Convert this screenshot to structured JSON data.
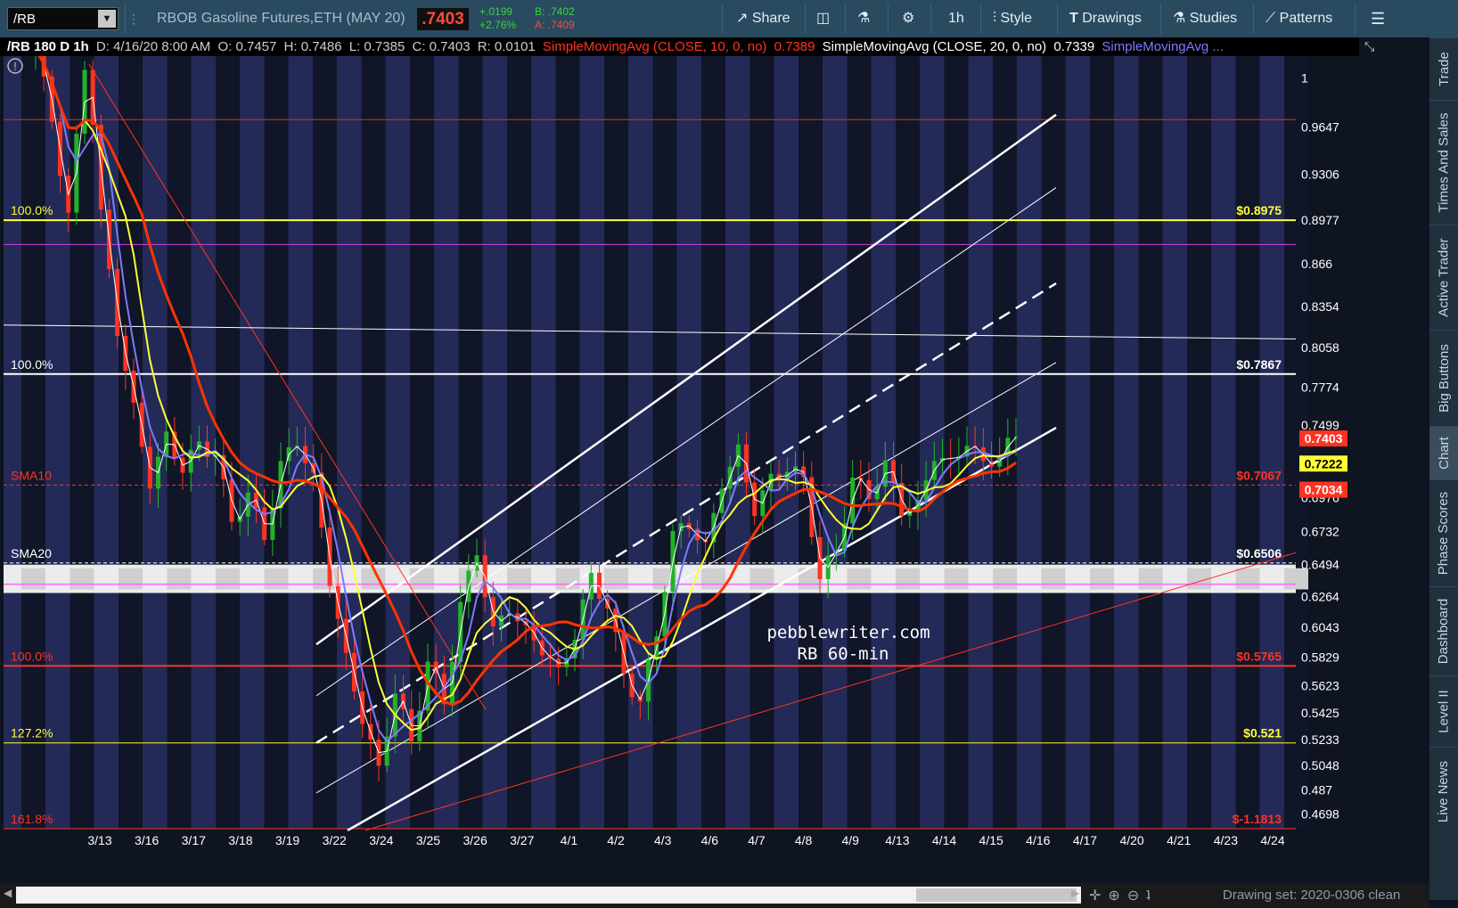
{
  "toolbar": {
    "symbol": "/RB",
    "description": "RBOB Gasoline Futures,ETH (MAY 20)",
    "last": ".7403",
    "change": "+.0199",
    "change_pct": "+2.76%",
    "bid": "B: .7402",
    "ask": "A: .7409",
    "share_label": "Share",
    "interval_label": "1h",
    "style_label": "Style",
    "drawings_label": "Drawings",
    "studies_label": "Studies",
    "patterns_label": "Patterns"
  },
  "header": {
    "title": "/RB 180 D 1h",
    "date": "D: 4/16/20 8:00 AM",
    "open": "O: 0.7457",
    "high": "H: 0.7486",
    "low": "L: 0.7385",
    "close": "C: 0.7403",
    "range": "R: 0.0101",
    "sma10": "SimpleMovingAvg (CLOSE, 10, 0, no)",
    "sma10_val": "0.7389",
    "sma20": "SimpleMovingAvg (CLOSE, 20, 0, no)",
    "sma20_val": "0.7339",
    "sma50": "SimpleMovingAvg ..."
  },
  "sidebar": {
    "items": [
      {
        "label": "Trade"
      },
      {
        "label": "Times And Sales"
      },
      {
        "label": "Active Trader"
      },
      {
        "label": "Big Buttons"
      },
      {
        "label": "Chart"
      },
      {
        "label": "Phase Scores"
      },
      {
        "label": "Dashboard"
      },
      {
        "label": "Level II"
      },
      {
        "label": "Live News"
      }
    ]
  },
  "bottom": {
    "drawing_set": "Drawing set: 2020-0306 clean"
  },
  "colors": {
    "background": "#242a57",
    "stripe": "#101528",
    "bull": "#22b22a",
    "bear": "#ff3322",
    "sma10": "#ffffff",
    "sma20": "#7b7bff",
    "sma50": "#ffff33",
    "sma100": "#ff3300"
  },
  "chart_data": {
    "type": "candlestick",
    "watermark": [
      "pebblewriter.com",
      "RB 60-min"
    ],
    "ylim": [
      0.4592,
      1.0157
    ],
    "y_ticks": [
      "1",
      "0.9647",
      "0.9306",
      "0.8977",
      "0.866",
      "0.8354",
      "0.8058",
      "0.7774",
      "0.7499",
      "0.7232",
      "0.6976",
      "0.6732",
      "0.6494",
      "0.6264",
      "0.6043",
      "0.5829",
      "0.5623",
      "0.5425",
      "0.5233",
      "0.5048",
      "0.487",
      "0.4698"
    ],
    "x_labels": [
      "3/13",
      "3/16",
      "3/17",
      "3/18",
      "3/19",
      "3/22",
      "3/24",
      "3/25",
      "3/26",
      "3/27",
      "4/1",
      "4/2",
      "4/3",
      "4/6",
      "4/7",
      "4/8",
      "4/9",
      "4/13",
      "4/14",
      "4/15",
      "4/16",
      "4/17",
      "4/20",
      "4/21",
      "4/23",
      "4/24"
    ],
    "price_badges": [
      {
        "value": "0.7403",
        "color": "#ff3322",
        "text": "#ffffff"
      },
      {
        "value": "0.7222",
        "color": "#ffff33",
        "text": "#000000"
      },
      {
        "value": "0.7034",
        "color": "#ff3322",
        "text": "#ffffff"
      }
    ],
    "price_path": [
      [
        0,
        1.02
      ],
      [
        2,
        0.97
      ],
      [
        4,
        0.9
      ],
      [
        6,
        1.01
      ],
      [
        7,
        0.97
      ],
      [
        8,
        0.9
      ],
      [
        10,
        0.82
      ],
      [
        12,
        0.76
      ],
      [
        14,
        0.71
      ],
      [
        16,
        0.74
      ],
      [
        18,
        0.72
      ],
      [
        20,
        0.735
      ],
      [
        22,
        0.73
      ],
      [
        24,
        0.68
      ],
      [
        26,
        0.7
      ],
      [
        28,
        0.67
      ],
      [
        30,
        0.72
      ],
      [
        32,
        0.74
      ],
      [
        34,
        0.71
      ],
      [
        36,
        0.64
      ],
      [
        38,
        0.58
      ],
      [
        40,
        0.54
      ],
      [
        42,
        0.5
      ],
      [
        44,
        0.56
      ],
      [
        46,
        0.52
      ],
      [
        48,
        0.58
      ],
      [
        50,
        0.55
      ],
      [
        52,
        0.62
      ],
      [
        54,
        0.66
      ],
      [
        56,
        0.6
      ],
      [
        58,
        0.62
      ],
      [
        60,
        0.6
      ],
      [
        62,
        0.59
      ],
      [
        64,
        0.57
      ],
      [
        66,
        0.6
      ],
      [
        68,
        0.64
      ],
      [
        70,
        0.62
      ],
      [
        72,
        0.57
      ],
      [
        74,
        0.55
      ],
      [
        76,
        0.6
      ],
      [
        78,
        0.67
      ],
      [
        80,
        0.68
      ],
      [
        82,
        0.66
      ],
      [
        84,
        0.71
      ],
      [
        86,
        0.73
      ],
      [
        88,
        0.69
      ],
      [
        90,
        0.71
      ],
      [
        92,
        0.72
      ],
      [
        94,
        0.71
      ],
      [
        96,
        0.64
      ],
      [
        98,
        0.66
      ],
      [
        100,
        0.71
      ],
      [
        102,
        0.7
      ],
      [
        104,
        0.72
      ],
      [
        106,
        0.69
      ],
      [
        108,
        0.69
      ],
      [
        110,
        0.73
      ],
      [
        112,
        0.72
      ],
      [
        114,
        0.74
      ],
      [
        116,
        0.72
      ],
      [
        118,
        0.73
      ],
      [
        120,
        0.7403
      ]
    ],
    "moving_averages": [
      {
        "name": "SMA10",
        "period": 10,
        "color": "#ffffff",
        "width": 1
      },
      {
        "name": "SMA20",
        "period": 20,
        "color": "#7b7bff",
        "width": 2
      },
      {
        "name": "SMA50",
        "period": 50,
        "color": "#ffff33",
        "width": 2
      },
      {
        "name": "SMA100",
        "period": 100,
        "color": "#ff3300",
        "width": 3
      }
    ],
    "levels": [
      {
        "value": 0.97,
        "label": "",
        "price": "",
        "color": "#e03020",
        "width": 1,
        "dash": ""
      },
      {
        "value": 0.8975,
        "label": "100.0%",
        "price": "$0.8975",
        "color": "#ffff33",
        "width": 2,
        "dash": ""
      },
      {
        "value": 0.88,
        "label": "",
        "price": "",
        "color": "#d040e0",
        "width": 1,
        "dash": ""
      },
      {
        "value": 0.7867,
        "label": "100.0%",
        "price": "$0.7867",
        "color": "#ffffff",
        "width": 2,
        "dash": ""
      },
      {
        "value": 0.7067,
        "label": "SMA10",
        "price": "$0.7067",
        "color": "#ff3322",
        "width": 1,
        "dash": "4,3"
      },
      {
        "value": 0.6506,
        "label": "SMA20",
        "price": "$0.6506",
        "color": "#ffffff",
        "width": 1,
        "dash": "4,3"
      },
      {
        "value": 0.5765,
        "label": "100.0%",
        "price": "$0.5765",
        "color": "#ff3322",
        "width": 2,
        "dash": ""
      },
      {
        "value": 0.521,
        "label": "127.2%",
        "price": "$0.521",
        "color": "#ffff33",
        "width": 1,
        "dash": ""
      },
      {
        "value": 0.4592,
        "label": "161.8%",
        "price": "$-1.1813",
        "color": "#ff3322",
        "width": 1,
        "dash": ""
      }
    ]
  }
}
